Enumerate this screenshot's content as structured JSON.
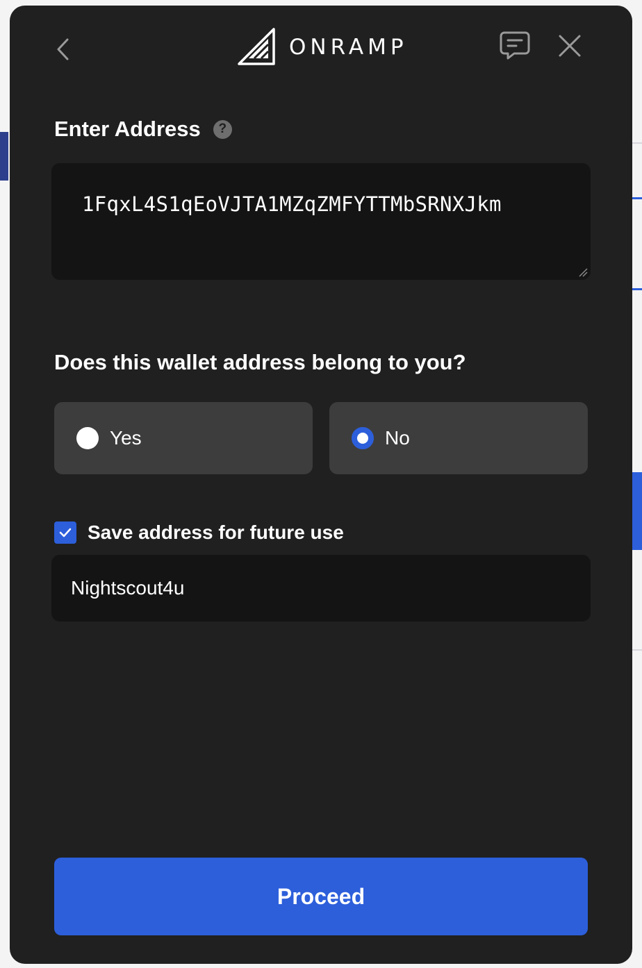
{
  "header": {
    "brand_name": "ONRAMP",
    "back_icon": "chevron-left-icon",
    "chat_icon": "chat-bubble-icon",
    "close_icon": "close-icon"
  },
  "address": {
    "label": "Enter Address",
    "help_icon": "question-icon",
    "help_glyph": "?",
    "value": "1FqxL4S1qEoVJTA1MZqZMFYTTMbSRNXJkm"
  },
  "ownership": {
    "question": "Does this wallet address belong to you?",
    "options": [
      {
        "label": "Yes",
        "selected": false
      },
      {
        "label": "No",
        "selected": true
      }
    ]
  },
  "save": {
    "checked": true,
    "label": "Save address for future use",
    "nickname": "Nightscout4u"
  },
  "actions": {
    "proceed_label": "Proceed"
  },
  "colors": {
    "modal_bg": "#202020",
    "field_bg": "#141414",
    "option_bg": "#3d3d3d",
    "accent": "#2d5fdb"
  }
}
